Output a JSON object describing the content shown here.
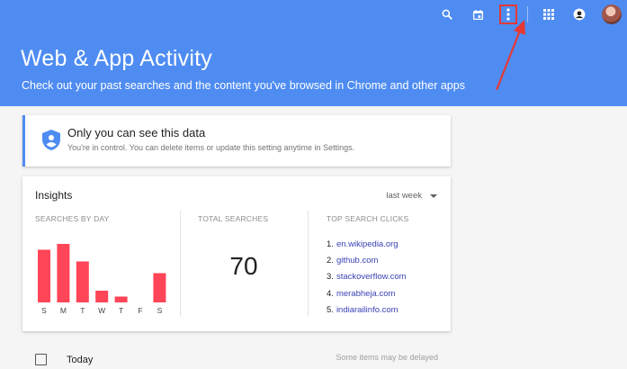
{
  "header": {
    "title": "Web & App Activity",
    "subtitle": "Check out your past searches and the content you've browsed in Chrome and other apps",
    "background": "#4e8cf2",
    "toolbar": [
      "search-icon",
      "calendar-icon",
      "more-vert-icon",
      "apps-grid-icon",
      "account-circle-icon",
      "avatar"
    ]
  },
  "privacy_card": {
    "title": "Only you can see this data",
    "text": "You're in control. You can delete items or update this setting anytime in Settings.",
    "icon": "shield-account-icon"
  },
  "insights": {
    "title": "Insights",
    "range": "last week",
    "searches_by_day": {
      "label": "SEARCHES BY DAY",
      "days": [
        "S",
        "M",
        "T",
        "W",
        "T",
        "F",
        "S"
      ],
      "values": [
        9,
        10,
        7,
        2,
        1,
        0,
        5
      ],
      "color": "#ff4558"
    },
    "total_searches": {
      "label": "TOTAL SEARCHES",
      "value": "70"
    },
    "top_search_clicks": {
      "label": "TOP SEARCH CLICKS",
      "items": [
        {
          "rank": "1.",
          "site": "en.wikipedia.org"
        },
        {
          "rank": "2.",
          "site": "github.com"
        },
        {
          "rank": "3.",
          "site": "stackoverflow.com"
        },
        {
          "rank": "4.",
          "site": "merabheja.com"
        },
        {
          "rank": "5.",
          "site": "indiarailinfo.com"
        }
      ]
    }
  },
  "activity": {
    "group_label": "Today",
    "note": "Some items may be delayed"
  },
  "annotation": {
    "color": "#e53935"
  }
}
